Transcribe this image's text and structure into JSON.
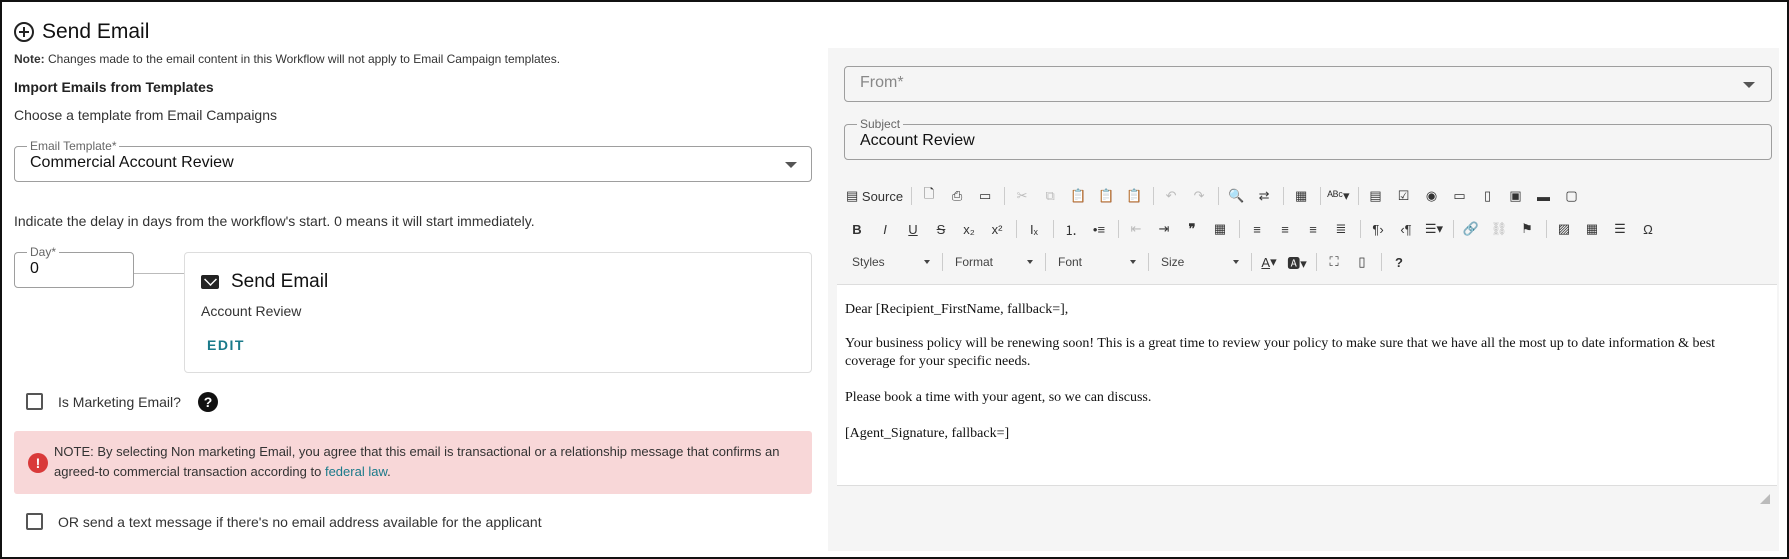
{
  "header": {
    "title": "Send Email",
    "note_bold": "Note:",
    "note_text": " Changes made to the email content in this Workflow will not apply to Email Campaign templates."
  },
  "import": {
    "heading": "Import Emails from Templates",
    "subtext": "Choose a template from Email Campaigns"
  },
  "template_field": {
    "label": "Email Template*",
    "value": "Commercial Account Review"
  },
  "delay": {
    "text": "Indicate the delay in days from the workflow's start. 0 means it will start immediately."
  },
  "day_field": {
    "label": "Day*",
    "value": "0"
  },
  "card": {
    "title": "Send Email",
    "subject": "Account Review",
    "edit_label": "EDIT"
  },
  "marketing": {
    "label": "Is Marketing Email?",
    "help": "?"
  },
  "alert": {
    "icon": "!",
    "text": "NOTE: By selecting Non marketing Email, you agree that this email is transactional or a relationship message that confirms an agreed-to commercial transaction according to ",
    "link": "federal law",
    "suffix": "."
  },
  "sms": {
    "label": "OR send a text message if there's no email address available for the applicant"
  },
  "from_field": {
    "placeholder": "From*"
  },
  "subject_field": {
    "label": "Subject",
    "value": "Account Review"
  },
  "toolbar": {
    "source_label": "Source",
    "styles_label": "Styles",
    "format_label": "Format",
    "font_label": "Font",
    "size_label": "Size",
    "omega": "Ω",
    "help": "?"
  },
  "editor": {
    "line1": "Dear [Recipient_FirstName, fallback=],",
    "line2": "Your business policy will be renewing soon! This is a great time to review your policy to make sure that we have all the most up to date information & best coverage for your specific needs.",
    "line3": "Please book a time with your agent, so we can discuss.",
    "line4": "[Agent_Signature, fallback=]"
  },
  "colors": {
    "accent": "#1a7a8a",
    "alert_bg": "#f8d7d8",
    "alert_icon": "#d93a3a",
    "panel_bg": "#f5f5f5"
  }
}
